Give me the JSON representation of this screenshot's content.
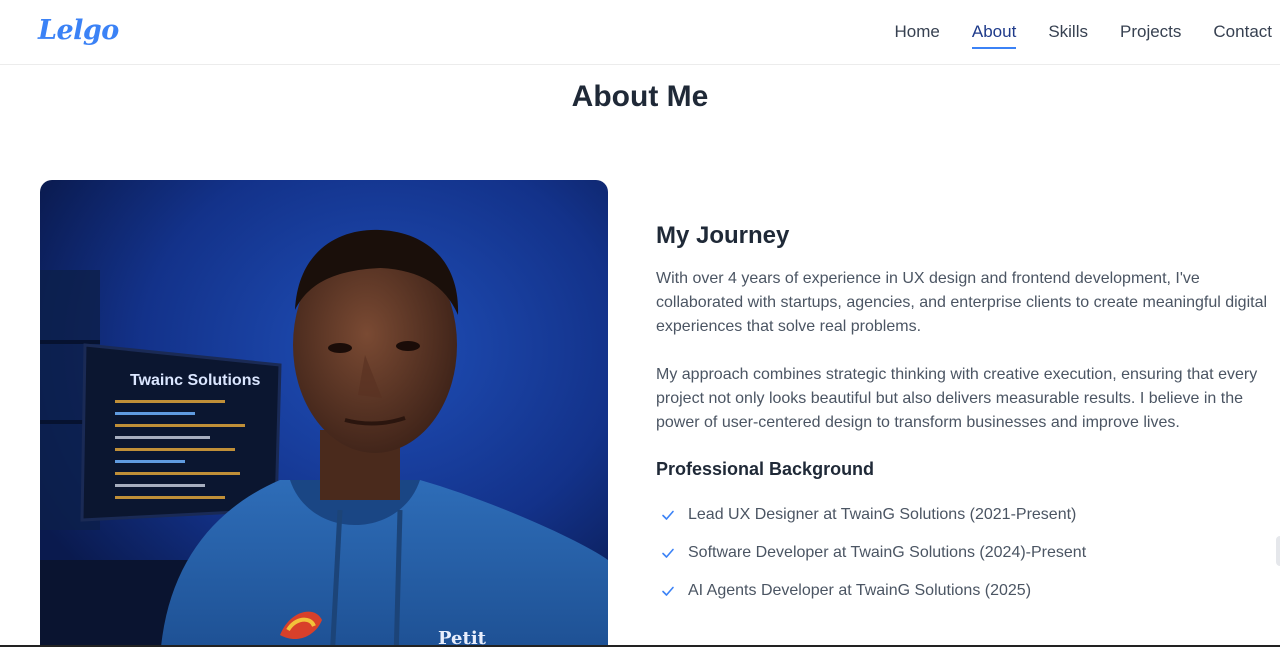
{
  "header": {
    "logo": "Lelgo",
    "nav": [
      {
        "label": "Home",
        "active": false
      },
      {
        "label": "About",
        "active": true
      },
      {
        "label": "Skills",
        "active": false
      },
      {
        "label": "Projects",
        "active": false
      },
      {
        "label": "Contact",
        "active": false
      }
    ]
  },
  "about": {
    "title": "About Me",
    "photo": {
      "monitor_text": "Twainс Solutions",
      "hoodie_text": "Petit"
    },
    "journey_title": "My Journey",
    "paragraphs": [
      "With over 4 years of experience in UX design and frontend development, I've collaborated with startups, agencies, and enterprise clients to create meaningful digital experiences that solve real problems.",
      "My approach combines strategic thinking with creative execution, ensuring that every project not only looks beautiful but also delivers measurable results. I believe in the power of user-centered design to transform businesses and improve lives."
    ],
    "background_title": "Professional Background",
    "background": [
      "Lead UX Designer at TwainG Solutions (2021-Present)",
      "Software Developer at TwainG Solutions (2024)-Present",
      "AI Agents Developer at TwainG Solutions (2025)"
    ]
  },
  "colors": {
    "accent": "#3b82f6",
    "heading": "#1f2937",
    "body_text": "#4b5563"
  },
  "icons": {
    "check": "check-icon"
  }
}
